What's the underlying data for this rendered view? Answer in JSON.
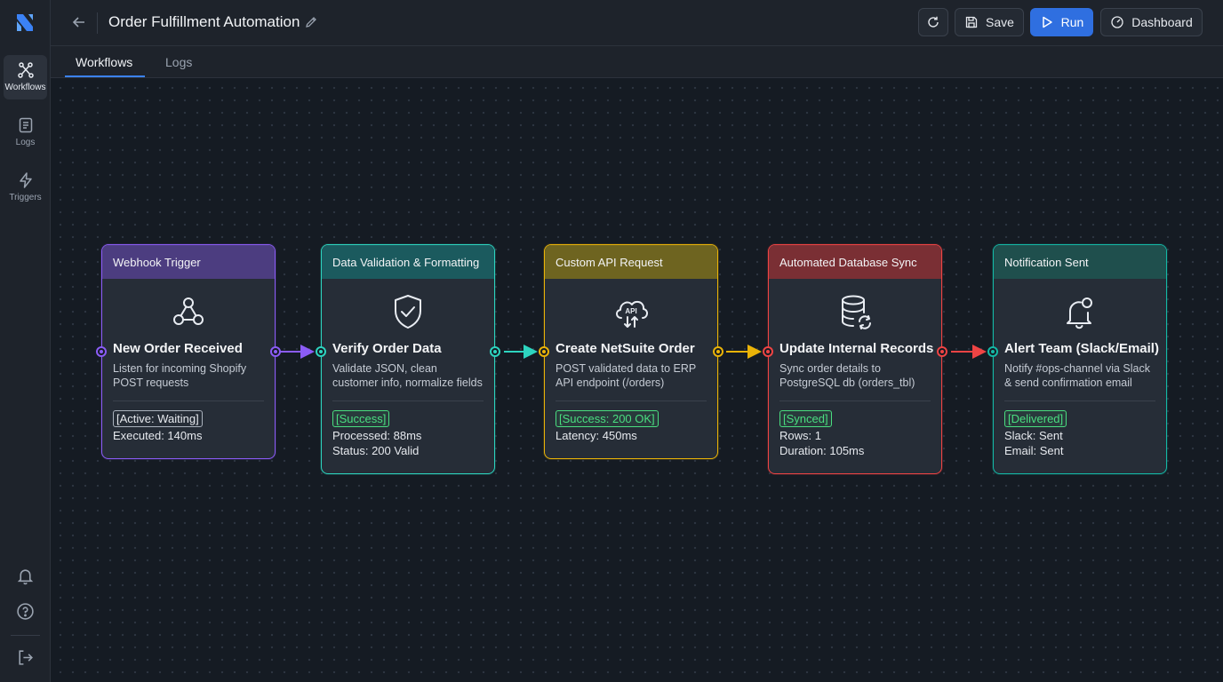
{
  "app": {
    "title": "Order Fulfillment Automation"
  },
  "rail": {
    "items": [
      {
        "label": "Workflows",
        "icon": "workflow-icon",
        "active": true
      },
      {
        "label": "Logs",
        "icon": "logs-icon",
        "active": false
      },
      {
        "label": "Triggers",
        "icon": "lightning-icon",
        "active": false
      }
    ],
    "bottom_icons": [
      "bell-icon",
      "help-icon",
      "logout-icon"
    ]
  },
  "toolbar": {
    "refresh_icon": "refresh-icon",
    "save_label": "Save",
    "run_label": "Run",
    "dashboard_label": "Dashboard"
  },
  "tabs": [
    {
      "label": "Workflows",
      "active": true
    },
    {
      "label": "Logs",
      "active": false
    }
  ],
  "colors": {
    "accent": "#2f6fe0",
    "purple": "#8b5cf6",
    "teal": "#2dd4bf",
    "yellow": "#eab308",
    "red": "#ef4444",
    "green_teal": "#14b8a6",
    "success": "#22c55e"
  },
  "nodes": [
    {
      "header": "Webhook Trigger",
      "icon": "webhook-icon",
      "name": "New Order Received",
      "desc": "Listen for incoming Shopify POST requests",
      "badge": "[Active: Waiting]",
      "stats": [
        "Executed: 140ms"
      ],
      "color": "#8b5cf6",
      "head_bg": "#4c3d80"
    },
    {
      "header": "Data Validation & Formatting",
      "icon": "shield-check-icon",
      "name": "Verify Order Data",
      "desc": "Validate JSON, clean customer info, normalize fields",
      "badge": "[Success]",
      "stats": [
        "Processed: 88ms",
        "Status: 200 Valid"
      ],
      "color": "#2dd4bf",
      "head_bg": "#1b5a5e"
    },
    {
      "header": "Custom API Request",
      "icon": "cloud-api-icon",
      "name": "Create NetSuite Order",
      "desc": "POST validated data to ERP API endpoint (/orders)",
      "badge": "[Success: 200 OK]",
      "stats": [
        "Latency: 450ms"
      ],
      "color": "#eab308",
      "head_bg": "#6e6420"
    },
    {
      "header": "Automated Database Sync",
      "icon": "database-sync-icon",
      "name": "Update Internal Records",
      "desc": "Sync order details to PostgreSQL db (orders_tbl)",
      "badge": "[Synced]",
      "stats": [
        "Rows: 1",
        "Duration: 105ms"
      ],
      "color": "#ef4444",
      "head_bg": "#7a2f34"
    },
    {
      "header": "Notification Sent",
      "icon": "bell-notification-icon",
      "name": "Alert Team (Slack/Email)",
      "desc": "Notify #ops-channel via Slack & send confirmation email",
      "badge": "[Delivered]",
      "stats": [
        "Slack: Sent",
        "Email: Sent"
      ],
      "color": "#14b8a6",
      "head_bg": "#1f4f4d"
    }
  ]
}
